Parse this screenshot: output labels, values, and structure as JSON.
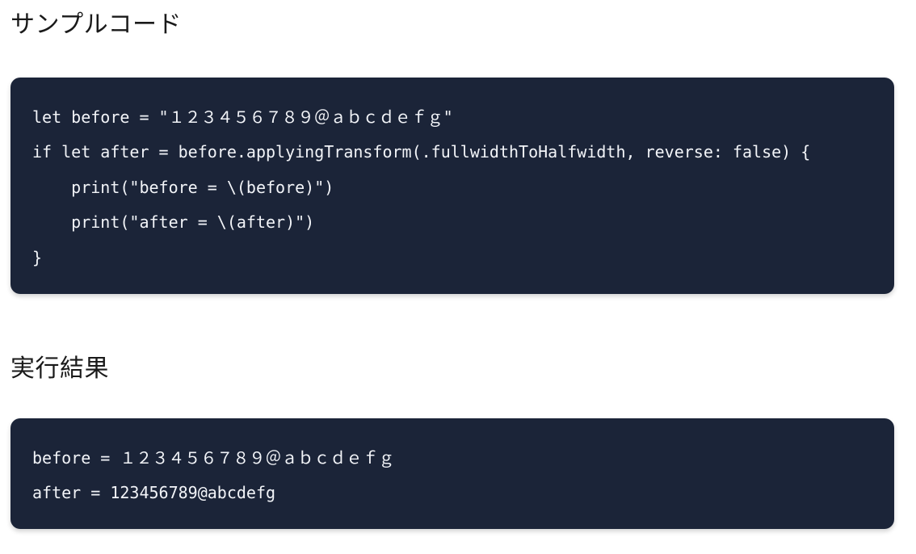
{
  "sections": {
    "sample_code": {
      "title": "サンプルコード",
      "lines": [
        "let before = \"１２３４５６７８９＠ａｂｃｄｅｆｇ\"",
        "if let after = before.applyingTransform(.fullwidthToHalfwidth, reverse: false) {",
        "    print(\"before = \\(before)\")",
        "    print(\"after = \\(after)\")",
        "}"
      ]
    },
    "result": {
      "title": "実行結果",
      "lines": [
        "before = １２３４５６７８９＠ａｂｃｄｅｆｇ",
        "after = 123456789@abcdefg"
      ]
    }
  },
  "colors": {
    "code_background": "#1b2438",
    "code_text": "#f2f4f8",
    "page_background": "#ffffff"
  }
}
